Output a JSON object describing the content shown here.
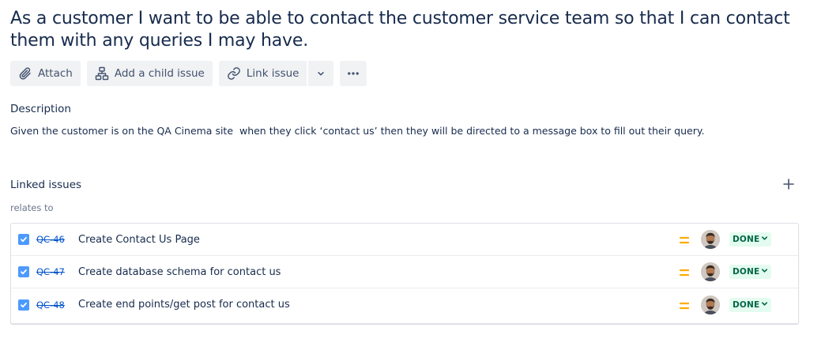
{
  "issue": {
    "title": "As a customer I want to be able to contact the customer service team so that I can contact them with any queries I may have."
  },
  "toolbar": {
    "attach_label": "Attach",
    "add_child_label": "Add a child issue",
    "link_issue_label": "Link issue"
  },
  "description": {
    "heading": "Description",
    "text": "Given the customer is on the QA Cinema site  when they click ‘contact us’ then they will be directed to a message box to fill out their query."
  },
  "linked_issues": {
    "heading": "Linked issues",
    "relation": "relates to",
    "items": [
      {
        "key": "QC-46",
        "summary": "Create Contact Us Page",
        "status": "DONE",
        "priority": "medium",
        "done": true
      },
      {
        "key": "QC-47",
        "summary": "Create database schema for contact us",
        "status": "DONE",
        "priority": "medium",
        "done": true
      },
      {
        "key": "QC-48",
        "summary": "Create end points/get post for contact us",
        "status": "DONE",
        "priority": "medium",
        "done": true
      }
    ]
  },
  "colors": {
    "link": "#0052cc",
    "priority_medium": "#ffab00",
    "status_done_bg": "#e3fcef",
    "status_done_text": "#006644",
    "checkbox": "#4c9aff"
  },
  "icons": {
    "attach": "paperclip-icon",
    "child": "hierarchy-icon",
    "link": "link-icon",
    "caret": "chevron-down-icon",
    "more": "more-icon",
    "add": "plus-icon",
    "checkbox": "checkbox-icon",
    "priority": "priority-medium-icon",
    "avatar": "avatar"
  }
}
